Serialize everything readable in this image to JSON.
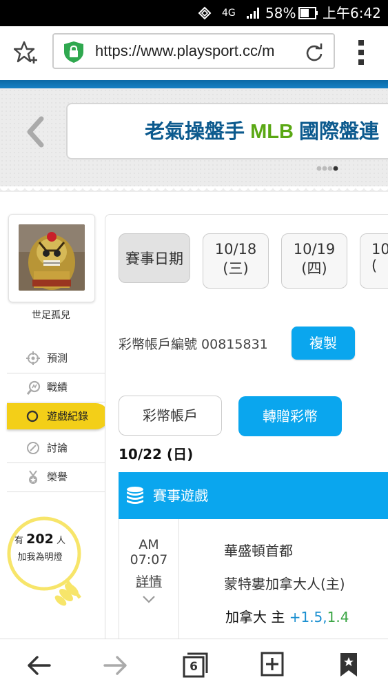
{
  "status_bar": {
    "network": "4G",
    "battery": "58%",
    "time": "上午6:42"
  },
  "browser": {
    "url": "https://www.playsport.cc/m",
    "tab_count": "6"
  },
  "banner": {
    "text_part1": "老氣操盤手",
    "text_part2": "MLB",
    "text_part3": "國際盤連"
  },
  "user": {
    "name": "世足孤兒"
  },
  "sidebar": {
    "items": [
      {
        "label": "預測"
      },
      {
        "label": "戰績"
      },
      {
        "label": "遊戲紀錄"
      },
      {
        "label": "討論"
      },
      {
        "label": "榮譽"
      }
    ]
  },
  "fans": {
    "prefix": "有",
    "count": "202",
    "suffix": "人",
    "line2": "加我為明燈"
  },
  "date_tabs": {
    "label": "賽事日期",
    "items": [
      {
        "date": "10/18",
        "weekday": "(三)"
      },
      {
        "date": "10/19",
        "weekday": "(四)"
      },
      {
        "date": "10",
        "weekday": "("
      }
    ]
  },
  "account": {
    "label": "彩幣帳戶編號 00815831",
    "copy_button": "複製"
  },
  "account_buttons": {
    "account": "彩幣帳戶",
    "transfer": "轉贈彩幣"
  },
  "section_date": "10/22 (日)",
  "games_header": "賽事遊戲",
  "game": {
    "ampm": "AM",
    "time": "07:07",
    "details_link": "詳情",
    "away_team": "華盛頓首都",
    "home_team": "蒙特婁加拿大人(主)",
    "pick_label": "加拿大 主",
    "pick_line": "+1.5,",
    "pick_odds": "1.4"
  },
  "colors": {
    "accent_blue": "#0aa6ee",
    "banner_blue": "#0c5a8e",
    "banner_green": "#5aa814",
    "odds_blue": "#1a8fd0",
    "odds_green": "#3aa544",
    "sidebar_active": "#f3cf18"
  }
}
